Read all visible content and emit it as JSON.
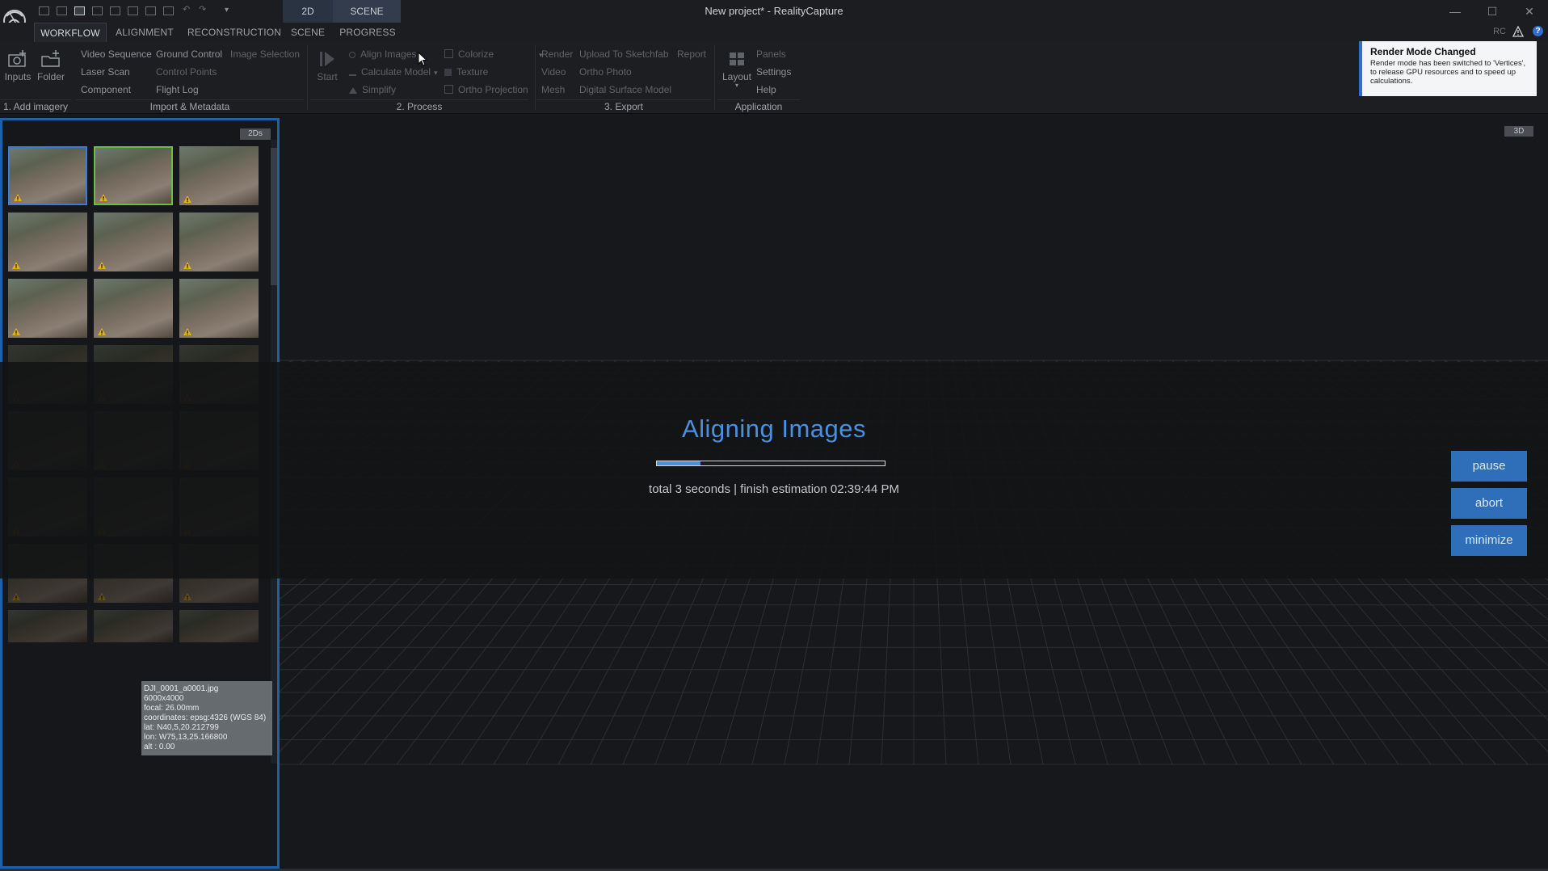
{
  "window": {
    "title": "New project* - RealityCapture",
    "mode_tabs": [
      "2D",
      "SCENE"
    ],
    "controls": [
      "—",
      "☐",
      "✕"
    ]
  },
  "menu": {
    "tabs": [
      "WORKFLOW",
      "ALIGNMENT",
      "RECONSTRUCTION",
      "SCENE",
      "PROGRESS"
    ],
    "active": "WORKFLOW",
    "rc_label": "RC",
    "help": "?"
  },
  "ribbon": {
    "add_imagery": {
      "inputs": "Inputs",
      "folder": "Folder",
      "label": "1. Add imagery"
    },
    "import_metadata": {
      "col1": [
        "Video Sequence",
        "Laser Scan",
        "Component"
      ],
      "col2": [
        "Ground Control",
        "Control Points",
        "Flight Log"
      ],
      "col3": [
        "Image Selection"
      ],
      "label": "Import & Metadata"
    },
    "process": {
      "start": "Start",
      "col1": [
        "Align Images",
        "Calculate Model",
        "Simplify"
      ],
      "col2": [
        "Colorize",
        "Texture",
        "Ortho Projection"
      ],
      "label": "2. Process"
    },
    "export": {
      "col1": [
        "Render",
        "Video",
        "Mesh"
      ],
      "col2": [
        "Upload To Sketchfab",
        "Ortho Photo",
        "Digital Surface Model"
      ],
      "col3": [
        "Report"
      ],
      "label": "3. Export"
    },
    "application": {
      "layout": "Layout",
      "col": [
        "Panels",
        "Settings",
        "Help"
      ],
      "label": "Application"
    }
  },
  "toast": {
    "title": "Render Mode Changed",
    "body": "Render mode has been switched to 'Vertices', to release GPU resources and to speed up calculations."
  },
  "panel2d": {
    "badge": "2Ds",
    "tooltip_lines": [
      "DJI_0001_a0001.jpg",
      "6000x4000",
      "focal: 26.00mm",
      "coordinates: epsg:4326 (WGS 84)",
      "lat: N40,5,20.212799",
      "lon: W75,13,25.166800",
      "alt : 0.00"
    ]
  },
  "scene": {
    "badge": "3D"
  },
  "progress": {
    "title": "Aligning Images",
    "fraction": 0.19,
    "status": "total 3 seconds | finish estimation 02:39:44 PM",
    "buttons": [
      "pause",
      "abort",
      "minimize"
    ]
  },
  "colors": {
    "accent": "#4a8fe0",
    "panel_border": "#1f5fa8",
    "button": "#2f6fba",
    "warning": "#e0b020"
  }
}
